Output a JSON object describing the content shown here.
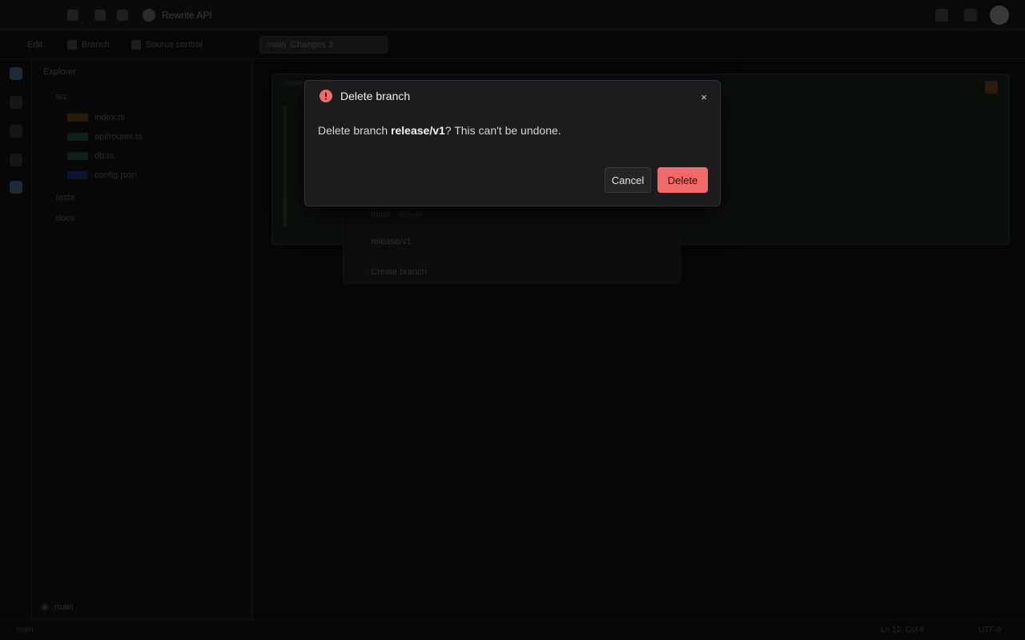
{
  "app": {
    "project_name": "Rewrite API",
    "toolbar": {
      "items": [
        "Edit",
        "Branch",
        "Source control",
        "main",
        "Changes 3"
      ]
    },
    "sidebar": {
      "header": "Explorer",
      "folders": [
        "src",
        "tests",
        "docs"
      ],
      "files": [
        "index.ts",
        "api/routes.ts",
        "db.ts",
        "config.json"
      ],
      "footer_label": "main"
    },
    "editor": {
      "tabs": "routes.ts  ·  db.ts  ·  index.ts"
    },
    "branch_dropdown": {
      "rows": [
        {
          "name": "main",
          "tag": "default"
        },
        {
          "name": "release/v1",
          "tag": ""
        },
        {
          "name": "Create branch",
          "tag": ""
        }
      ]
    },
    "statusbar": {
      "left": "main",
      "right_1": "Ln 12, Col 8",
      "right_2": "UTF-8"
    }
  },
  "dialog": {
    "title": "Delete branch",
    "message_prefix": "Delete branch ",
    "branch_name": "release/v1",
    "message_suffix": "? This can't be undone.",
    "cancel_label": "Cancel",
    "delete_label": "Delete",
    "close_glyph": "×"
  },
  "colors": {
    "danger": "#f06a6a",
    "dialog_bg": "#1c1c1e",
    "overlay_bg": "#050505"
  },
  "icons": {
    "warning": "alert-circle-icon",
    "close": "close-icon"
  }
}
